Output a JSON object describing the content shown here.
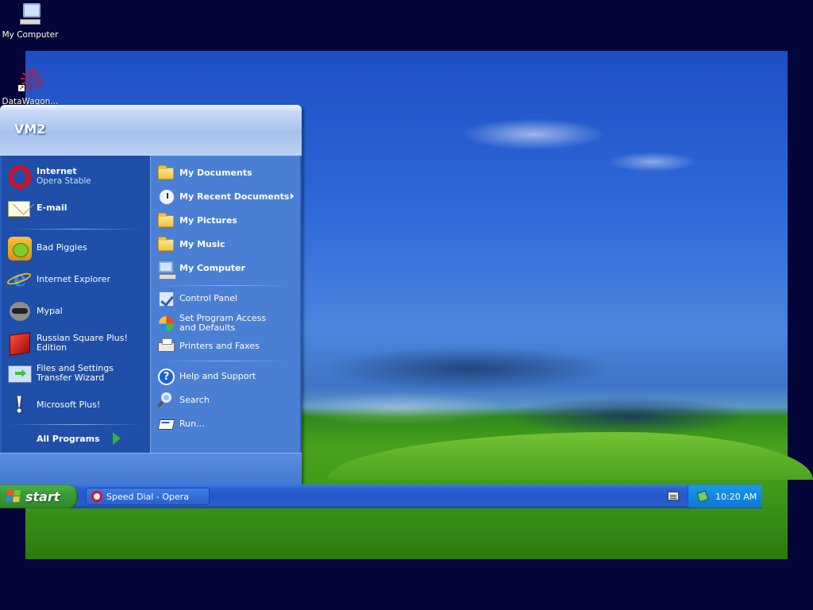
{
  "desktop": {
    "icons": [
      {
        "label": "My Computer"
      },
      {
        "label": "DataWagon..."
      }
    ]
  },
  "start_menu": {
    "username": "VM2",
    "pinned": [
      {
        "title": "Internet",
        "subtitle": "Opera Stable",
        "icon": "opera-icon"
      },
      {
        "title": "E-mail",
        "icon": "email-icon"
      }
    ],
    "recent": [
      {
        "label": "Bad Piggies",
        "icon": "bad-piggies-icon"
      },
      {
        "label": "Internet Explorer",
        "icon": "internet-explorer-icon"
      },
      {
        "label": "Mypal",
        "icon": "mypal-icon"
      },
      {
        "label": "Russian Square Plus! Edition",
        "icon": "russian-square-icon"
      },
      {
        "label": "Files and Settings Transfer Wizard",
        "icon": "transfer-wizard-icon"
      },
      {
        "label": "Microsoft Plus!",
        "icon": "microsoft-plus-icon"
      }
    ],
    "all_programs": "All Programs",
    "places": [
      {
        "label": "My Documents",
        "icon": "folder-icon"
      },
      {
        "label": "My Recent Documents",
        "icon": "recent-documents-icon"
      },
      {
        "label": "My Pictures",
        "icon": "folder-icon"
      },
      {
        "label": "My Music",
        "icon": "folder-icon"
      },
      {
        "label": "My Computer",
        "icon": "computer-icon"
      }
    ],
    "system": [
      {
        "label": "Control Panel",
        "icon": "control-panel-icon"
      },
      {
        "label": "Set Program Access and Defaults",
        "icon": "program-access-icon"
      },
      {
        "label": "Printers and Faxes",
        "icon": "printer-icon"
      }
    ],
    "support": [
      {
        "label": "Help and Support",
        "icon": "help-icon"
      },
      {
        "label": "Search",
        "icon": "search-icon"
      },
      {
        "label": "Run...",
        "icon": "run-icon"
      }
    ]
  },
  "taskbar": {
    "start_label": "start",
    "tasks": [
      {
        "label": "Speed Dial - Opera",
        "icon": "opera-icon"
      }
    ],
    "clock": "10:20 AM"
  },
  "colors": {
    "desktop_bg": "#04063a",
    "taskbar_blue": "#2457c8",
    "start_green": "#3a9c36",
    "menu_left": "#1f4fa8",
    "menu_right": "#4a7fd4"
  }
}
